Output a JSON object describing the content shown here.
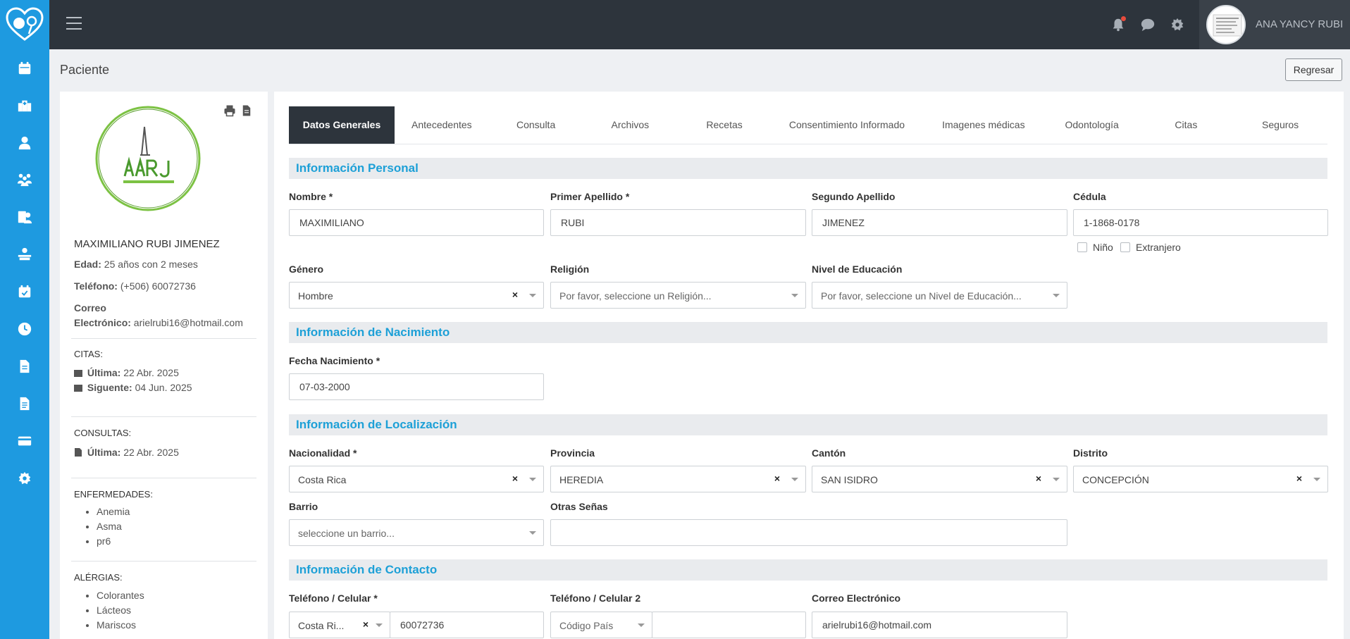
{
  "app": {
    "user_name": "ANA YANCY RUBI"
  },
  "page": {
    "title": "Paciente",
    "back_label": "Regresar"
  },
  "profile": {
    "name": "MAXIMILIANO RUBI JIMENEZ",
    "age_label": "Edad:",
    "age": "25 años con 2 meses",
    "phone_label": "Teléfono:",
    "phone": "(+506) 60072736",
    "email_label_1": "Correo",
    "email_label_2": "Electrónico:",
    "email": "arielrubi16@hotmail.com",
    "citas_head": "CITAS:",
    "citas_last_label": "Última:",
    "citas_last": "22 Abr. 2025",
    "citas_next_label": "Siguente:",
    "citas_next": "04 Jun. 2025",
    "consultas_head": "CONSULTAS:",
    "consultas_last_label": "Última:",
    "consultas_last": "22 Abr. 2025",
    "enfermedades_head": "ENFERMEDADES:",
    "enfermedades": [
      "Anemia",
      "Asma",
      "pr6"
    ],
    "alergias_head": "ALÉRGIAS:",
    "alergias": [
      "Colorantes",
      "Lácteos",
      "Mariscos"
    ]
  },
  "tabs": [
    "Datos Generales",
    "Antecedentes",
    "Consulta",
    "Archivos",
    "Recetas",
    "Consentimiento Informado",
    "Imagenes médicas",
    "Odontología",
    "Citas",
    "Seguros"
  ],
  "sections": {
    "personal": "Información Personal",
    "nacimiento": "Información de Nacimiento",
    "localizacion": "Información de Localización",
    "contacto": "Información de Contacto"
  },
  "form": {
    "nombre": {
      "label": "Nombre *",
      "value": "MAXIMILIANO"
    },
    "primer_apellido": {
      "label": "Primer Apellido *",
      "value": "RUBI"
    },
    "segundo_apellido": {
      "label": "Segundo Apellido",
      "value": "JIMENEZ"
    },
    "cedula": {
      "label": "Cédula",
      "value": "1-1868-0178"
    },
    "nino": "Niño",
    "extranjero": "Extranjero",
    "genero": {
      "label": "Género",
      "value": "Hombre"
    },
    "religion": {
      "label": "Religión",
      "placeholder": "Por favor, seleccione un Religión..."
    },
    "educacion": {
      "label": "Nivel de Educación",
      "placeholder": "Por favor, seleccione un Nivel de Educación..."
    },
    "fecha_nacimiento": {
      "label": "Fecha Nacimiento *",
      "value": "07-03-2000"
    },
    "nacionalidad": {
      "label": "Nacionalidad *",
      "value": "Costa Rica"
    },
    "provincia": {
      "label": "Provincia",
      "value": "HEREDIA"
    },
    "canton": {
      "label": "Cantón",
      "value": "SAN ISIDRO"
    },
    "distrito": {
      "label": "Distrito",
      "value": "CONCEPCIÓN"
    },
    "barrio": {
      "label": "Barrio",
      "placeholder": "seleccione un barrio..."
    },
    "otras_senas": {
      "label": "Otras Señas",
      "value": ""
    },
    "telefono": {
      "label": "Teléfono / Celular *",
      "country": "Costa Ri...",
      "value": "60072736"
    },
    "telefono2": {
      "label": "Teléfono / Celular 2",
      "country_placeholder": "Código País",
      "value": ""
    },
    "correo": {
      "label": "Correo Electrónico",
      "value": "arielrubi16@hotmail.com"
    }
  }
}
